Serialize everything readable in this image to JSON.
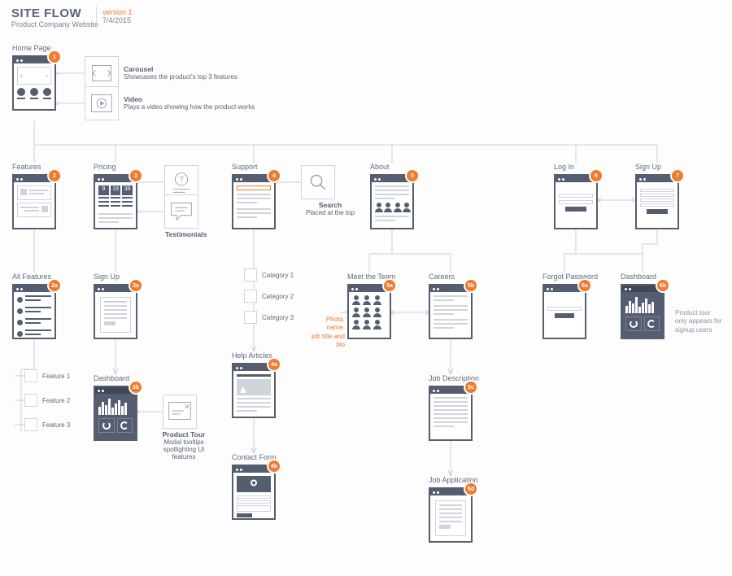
{
  "header": {
    "title": "SITE FLOW",
    "subtitle": "Product Company Website",
    "version": "version 1",
    "date": "7/4/2015"
  },
  "pages": {
    "home": {
      "label": "Home Page",
      "badge": "1"
    },
    "features": {
      "label": "Features",
      "badge": "2"
    },
    "all_features": {
      "label": "All Features",
      "badge": "2a"
    },
    "pricing": {
      "label": "Pricing",
      "badge": "3"
    },
    "signup3a": {
      "label": "Sign Up",
      "badge": "3a"
    },
    "dashboard3b": {
      "label": "Dashboard",
      "badge": "3b"
    },
    "support": {
      "label": "Support",
      "badge": "4"
    },
    "help_articles": {
      "label": "Help Articles",
      "badge": "4a"
    },
    "contact_form": {
      "label": "Contact Form",
      "badge": "4b"
    },
    "about": {
      "label": "About",
      "badge": "5"
    },
    "meet_team": {
      "label": "Meet the Team",
      "badge": "5a"
    },
    "careers": {
      "label": "Careers",
      "badge": "5b"
    },
    "job_desc": {
      "label": "Job Description",
      "badge": "5c"
    },
    "job_app": {
      "label": "Job Application",
      "badge": "5d"
    },
    "login": {
      "label": "Log In",
      "badge": "6"
    },
    "forgot": {
      "label": "Forgot Password",
      "badge": "6a"
    },
    "dashboard6b": {
      "label": "Dashboard",
      "badge": "6b"
    },
    "signup7": {
      "label": "Sign Up",
      "badge": "7"
    }
  },
  "annos": {
    "carousel": {
      "title": "Carousel",
      "desc": "Showcases the product's top 3 features"
    },
    "video": {
      "title": "Video",
      "desc": "Plays a video showing how the product works"
    },
    "faq": {
      "title": "FAQ"
    },
    "testi": {
      "title": "Testimonials"
    },
    "search": {
      "title": "Search",
      "desc": "Placed at the top"
    },
    "tour": {
      "title": "Product Tour",
      "desc": "Modal tooltips spotlighting UI features"
    }
  },
  "categories": [
    "Category 1",
    "Category 2",
    "Category 3"
  ],
  "features_list": [
    "Feature 1",
    "Feature 2",
    "Feature 3"
  ],
  "notes": {
    "team": "Photo, name,\njob title and bio",
    "dashboard6b": "Product tour only appears for signup users"
  },
  "pricing_numbers": [
    "9",
    "19",
    "39"
  ]
}
